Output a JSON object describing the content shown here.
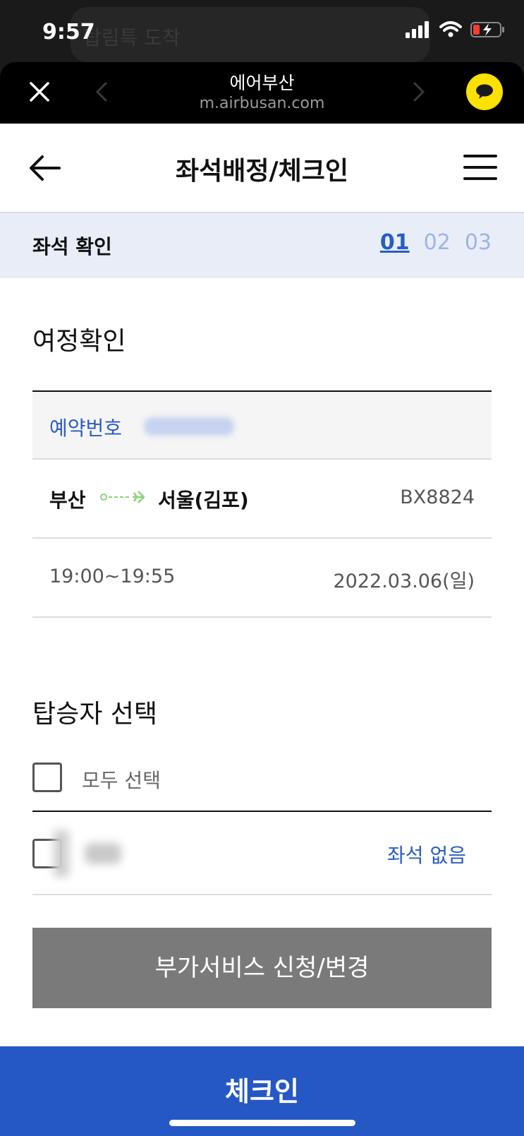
{
  "status_bar": {
    "time": "9:57"
  },
  "browser": {
    "background_hint": "탑림특 도착",
    "title": "에어부산",
    "url": "m.airbusan.com"
  },
  "header": {
    "title": "좌석배정/체크인"
  },
  "steps": {
    "label": "좌석 확인",
    "items": [
      "01",
      "02",
      "03"
    ],
    "active": "01"
  },
  "itinerary": {
    "title": "여정확인",
    "reservation_label": "예약번호",
    "from": "부산",
    "to": "서울(김포)",
    "flight_no": "BX8824",
    "time": "19:00~19:55",
    "date": "2022.03.06(일)"
  },
  "passengers": {
    "title": "탑승자 선택",
    "select_all_label": "모두 선택",
    "rows": [
      {
        "seat_status": "좌석 없음"
      }
    ]
  },
  "buttons": {
    "addon": "부가서비스 신청/변경",
    "checkin": "체크인"
  },
  "colors": {
    "accent": "#2558c4",
    "link_blue": "#2a5cc4",
    "step_bg": "#e8edf8",
    "kakao_yellow": "#fae100",
    "route_green": "#8fd07a",
    "addon_gray": "#7a7a7a"
  }
}
